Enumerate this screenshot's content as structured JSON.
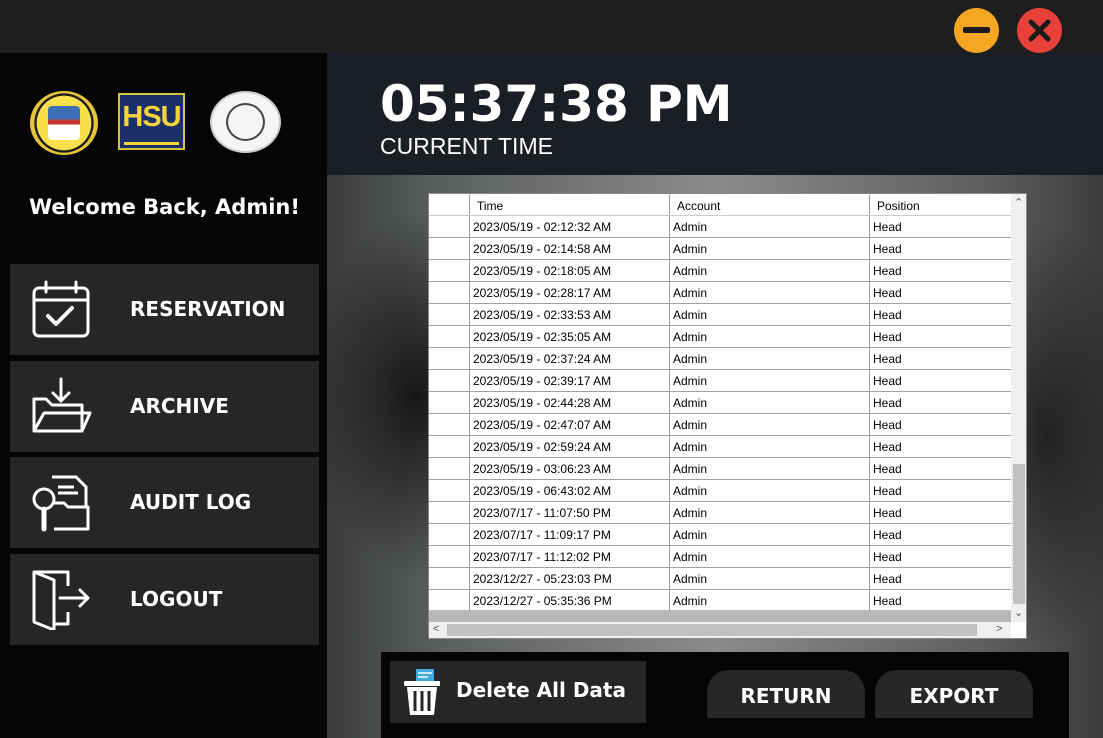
{
  "window": {
    "minimize_icon": "minimize-icon",
    "close_icon": "close-icon"
  },
  "sidebar": {
    "logos": [
      "University of Manila seal",
      "HSU",
      "UM Fitness Center"
    ],
    "logo_hsu_text": "HSU",
    "welcome": "Welcome Back, Admin!",
    "nav": [
      {
        "label": "RESERVATION",
        "icon": "calendar-check-icon"
      },
      {
        "label": "ARCHIVE",
        "icon": "archive-folder-icon"
      },
      {
        "label": "AUDIT LOG",
        "icon": "audit-log-icon"
      },
      {
        "label": "LOGOUT",
        "icon": "logout-door-icon"
      }
    ]
  },
  "header": {
    "clock": "05:37:38 PM",
    "clock_label": "CURRENT TIME"
  },
  "grid": {
    "columns": [
      "Time",
      "Account",
      "Position"
    ],
    "rows": [
      [
        "2023/05/19 - 02:12:32 AM",
        "Admin",
        "Head"
      ],
      [
        "2023/05/19 - 02:14:58 AM",
        "Admin",
        "Head"
      ],
      [
        "2023/05/19 - 02:18:05 AM",
        "Admin",
        "Head"
      ],
      [
        "2023/05/19 - 02:28:17 AM",
        "Admin",
        "Head"
      ],
      [
        "2023/05/19 - 02:33:53 AM",
        "Admin",
        "Head"
      ],
      [
        "2023/05/19 - 02:35:05 AM",
        "Admin",
        "Head"
      ],
      [
        "2023/05/19 - 02:37:24 AM",
        "Admin",
        "Head"
      ],
      [
        "2023/05/19 - 02:39:17 AM",
        "Admin",
        "Head"
      ],
      [
        "2023/05/19 - 02:44:28 AM",
        "Admin",
        "Head"
      ],
      [
        "2023/05/19 - 02:47:07 AM",
        "Admin",
        "Head"
      ],
      [
        "2023/05/19 - 02:59:24 AM",
        "Admin",
        "Head"
      ],
      [
        "2023/05/19 - 03:06:23 AM",
        "Admin",
        "Head"
      ],
      [
        "2023/05/19 - 06:43:02 AM",
        "Admin",
        "Head"
      ],
      [
        "2023/07/17 - 11:07:50 PM",
        "Admin",
        "Head"
      ],
      [
        "2023/07/17 - 11:09:17 PM",
        "Admin",
        "Head"
      ],
      [
        "2023/07/17 - 11:12:02 PM",
        "Admin",
        "Head"
      ],
      [
        "2023/12/27 - 05:23:03 PM",
        "Admin",
        "Head"
      ],
      [
        "2023/12/27 - 05:35:36 PM",
        "Admin",
        "Head"
      ]
    ]
  },
  "footer": {
    "delete_label": "Delete All Data",
    "delete_icon": "trash-icon",
    "return_label": "RETURN",
    "export_label": "EXPORT"
  }
}
